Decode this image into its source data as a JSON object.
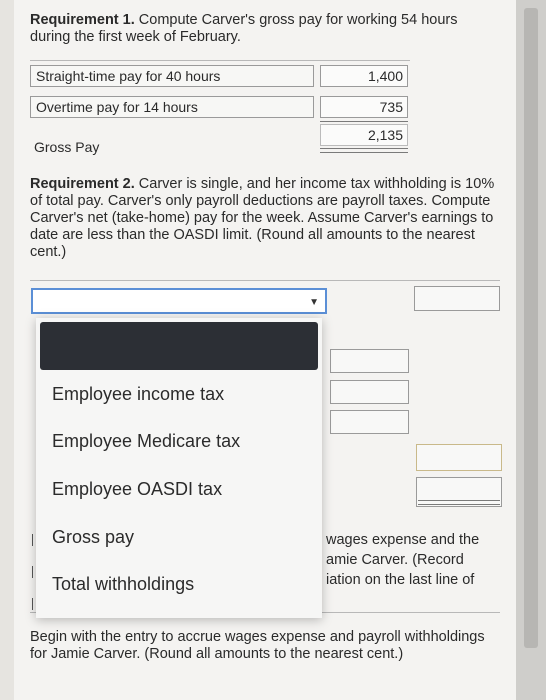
{
  "requirement1": {
    "label": "Requirement 1.",
    "text": " Compute Carver's gross pay for working 54 hours during the first week of February.",
    "rows": [
      {
        "label": "Straight-time pay for 40 hours",
        "amount": "1,400"
      },
      {
        "label": "Overtime pay for 14 hours",
        "amount": "735"
      }
    ],
    "gross_label": "Gross Pay",
    "gross_amount": "2,135"
  },
  "requirement2": {
    "label": "Requirement 2.",
    "text": " Carver is single, and her income tax withholding is 10% of total pay. Carver's only payroll deductions are payroll taxes. Compute Carver's net (take-home) pay for the week. Assume Carver's earnings to date are less than the OASDI limit. (Round all amounts to the nearest cent.)"
  },
  "dropdown": {
    "selected_value": "",
    "options": [
      "Employee income tax",
      "Employee Medicare tax",
      "Employee OASDI tax",
      "Gross pay",
      "Total withholdings"
    ]
  },
  "requirement3_partial": {
    "line1": "wages expense and the",
    "line2": "amie Carver. (Record",
    "line3": "iation on the last line of"
  },
  "journal_instruction": "Begin with the entry to accrue wages expense and payroll withholdings for Jamie Carver. (Round all amounts to the nearest cent.)"
}
